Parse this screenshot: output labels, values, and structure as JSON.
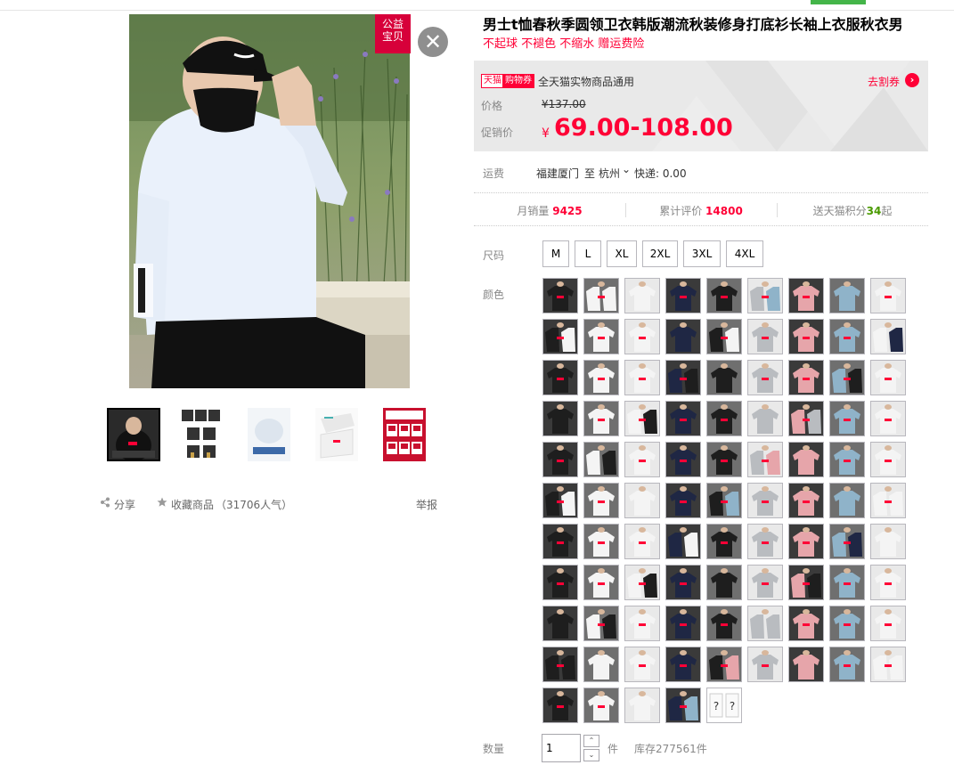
{
  "badge": {
    "line1": "公益",
    "line2": "宝贝"
  },
  "close_glyph": "✕",
  "share": {
    "label": "分享",
    "favorite": "收藏商品",
    "popularity": "（31706人气）",
    "report": "举报"
  },
  "product": {
    "title": "男士t恤春秋季圆领卫衣韩版潮流秋装修身打底衫长袖上衣服秋衣男",
    "subtitle": "不起球 不褪色 不缩水 赠运费险"
  },
  "coupon": {
    "tag_tmall": "天猫",
    "tag_coupon": "购物券",
    "text": "全天猫实物商品通用",
    "get": "去割券",
    "get_icon": "›"
  },
  "price": {
    "label": "价格",
    "original": "¥137.00",
    "promo_label": "促销价",
    "currency": "¥",
    "promo": "69.00-108.00"
  },
  "shipping": {
    "label": "运费",
    "from": "福建厦门",
    "to_word": "至",
    "to": "杭州",
    "chevron": "⌄",
    "express": "快递: 0.00"
  },
  "stats": {
    "monthly_label": "月销量",
    "monthly": "9425",
    "reviews_label": "累计评价",
    "reviews": "14800",
    "points_prefix": "送天猫积分",
    "points": "34",
    "points_suffix": "起"
  },
  "size_label": "尺码",
  "sizes": [
    "M",
    "L",
    "XL",
    "2XL",
    "3XL",
    "4XL"
  ],
  "color_label": "颜色",
  "color_unknown": "?",
  "quantity": {
    "label": "数量",
    "value": "1",
    "up": "⌃",
    "down": "⌄",
    "unit": "件",
    "stock": "库存277561件"
  },
  "colors": {
    "white": "#f4f4f4",
    "black": "#1e1e1e",
    "blue": "#8fb3c9",
    "pink": "#e6a5aa",
    "navy": "#1f2744",
    "grey": "#b9bcc0",
    "red": "#ff0036"
  }
}
